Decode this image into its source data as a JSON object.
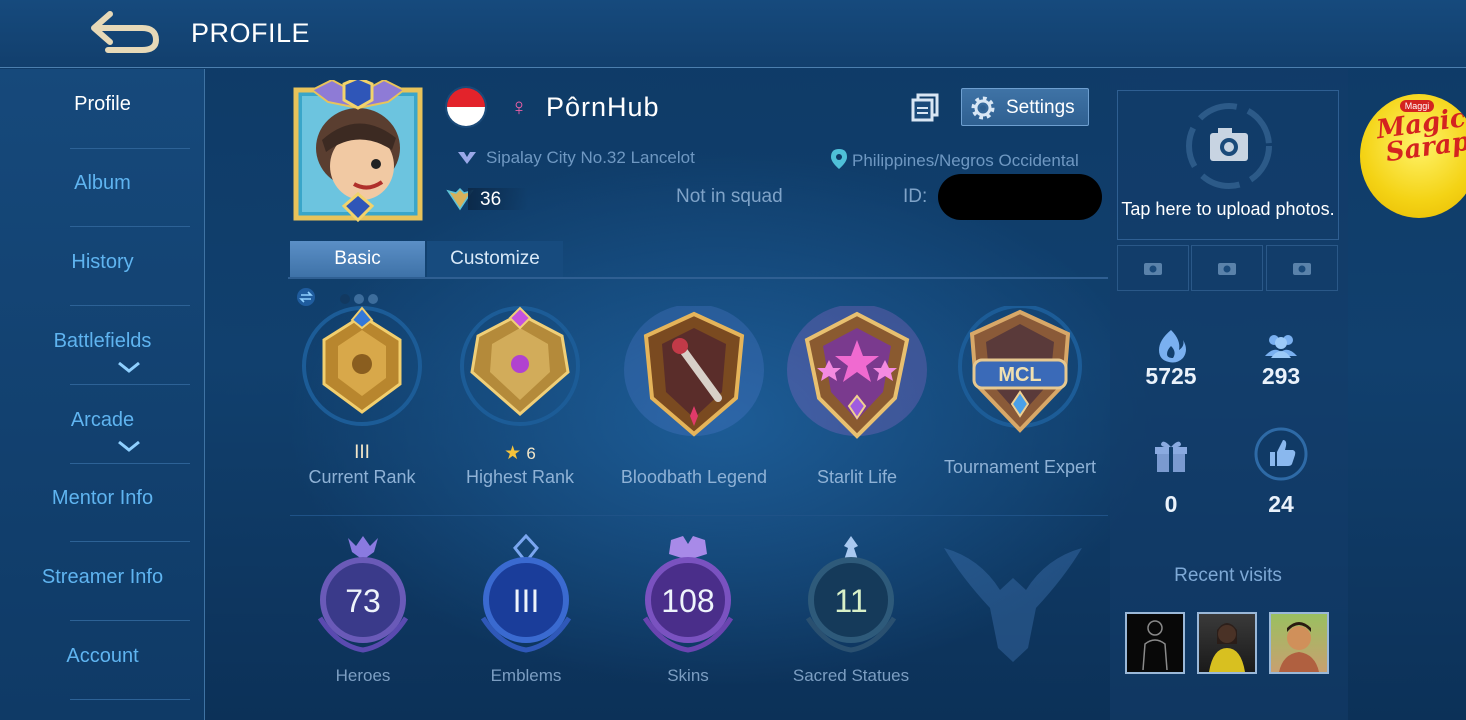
{
  "header": {
    "title": "PROFILE"
  },
  "sidebar": {
    "items": [
      {
        "label": "Profile"
      },
      {
        "label": "Album"
      },
      {
        "label": "History"
      },
      {
        "label": "Battlefields"
      },
      {
        "label": "Arcade"
      },
      {
        "label": "Mentor Info"
      },
      {
        "label": "Streamer Info"
      },
      {
        "label": "Account"
      }
    ]
  },
  "player": {
    "name": "PôrnHub",
    "gender_symbol": "♀",
    "title": "Sipalay City No.32 Lancelot",
    "location": "Philippines/Negros Occidental",
    "level": "36",
    "squad": "Not in squad",
    "id_label": "ID:"
  },
  "settings": {
    "label": "Settings"
  },
  "tabs": [
    {
      "label": "Basic"
    },
    {
      "label": "Customize"
    }
  ],
  "achievements": [
    {
      "sub": "III",
      "label": "Current Rank"
    },
    {
      "sub": "6",
      "label": "Highest Rank"
    },
    {
      "sub": "",
      "label": "Bloodbath Legend"
    },
    {
      "sub": "",
      "label": "Starlit Life"
    },
    {
      "sub": "",
      "label": "Tournament Expert"
    }
  ],
  "mcl_text": "MCL",
  "stats": [
    {
      "value": "73",
      "label": "Heroes"
    },
    {
      "value": "III",
      "label": "Emblems"
    },
    {
      "value": "108",
      "label": "Skins"
    },
    {
      "value": "11",
      "label": "Sacred Statues"
    }
  ],
  "upload": {
    "text": "Tap here to upload photos."
  },
  "social": {
    "popularity": "5725",
    "followers": "293",
    "gifts": "0",
    "likes": "24"
  },
  "recent_visits": {
    "title": "Recent visits"
  },
  "ad": {
    "brand": "Maggi",
    "line1": "Magic",
    "line2": "Sarap"
  },
  "colors": {
    "accent": "#5fb4f0",
    "gold": "#d8b15a",
    "background": "#11406e"
  }
}
